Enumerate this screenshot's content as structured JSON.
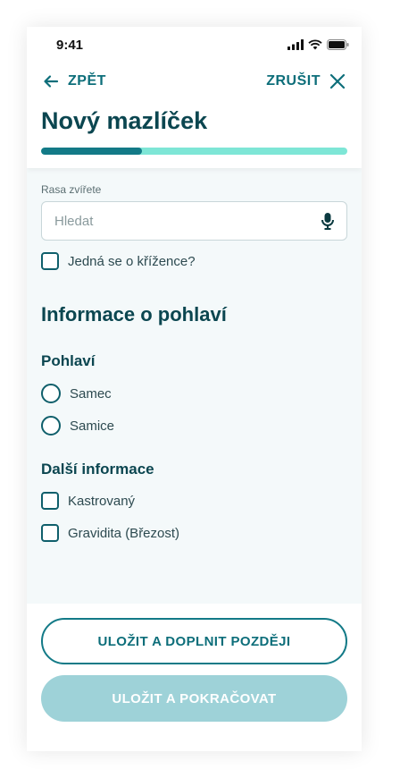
{
  "status_bar": {
    "time": "9:41"
  },
  "nav": {
    "back_label": "ZPĚT",
    "cancel_label": "ZRUŠIT"
  },
  "page_title": "Nový mazlíček",
  "progress": {
    "fraction": 0.33
  },
  "breed": {
    "label": "Rasa zvířete",
    "placeholder": "Hledat",
    "value": ""
  },
  "crossbreed": {
    "label": "Jedná se o křížence?",
    "checked": false
  },
  "gender_section": {
    "title": "Informace o pohlaví",
    "gender_label": "Pohlaví",
    "options": [
      "Samec",
      "Samice"
    ]
  },
  "extra_section": {
    "title": "Další informace",
    "options": [
      "Kastrovaný",
      "Gravidita (Březost)"
    ]
  },
  "buttons": {
    "save_later": "ULOŽIT A DOPLNIT POZDĚJI",
    "save_continue": "ULOŽIT A POKRAČOVAT"
  },
  "colors": {
    "primary": "#137a87",
    "progress_track": "#7ee6d6",
    "heading": "#0b4650",
    "disabled_button": "#9ed2d8"
  }
}
